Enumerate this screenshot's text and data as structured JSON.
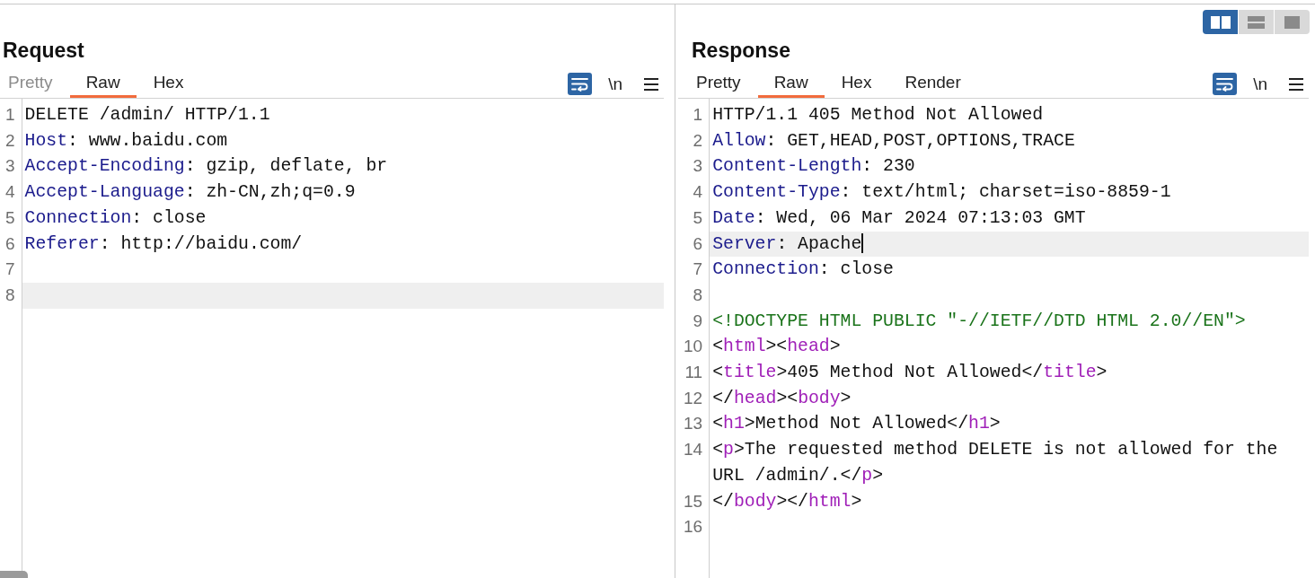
{
  "view_modes": [
    {
      "kind": "columns",
      "selected": true
    },
    {
      "kind": "rows",
      "selected": false
    },
    {
      "kind": "single",
      "selected": false
    }
  ],
  "panels": [
    {
      "title": "Request",
      "focused": false,
      "h_scrollbar": true,
      "tabs": [
        {
          "label": "Pretty",
          "selected": false,
          "disabled": true
        },
        {
          "label": "Raw",
          "selected": true,
          "disabled": false
        },
        {
          "label": "Hex",
          "selected": false,
          "disabled": false
        }
      ],
      "tools": [
        {
          "kind": "wrap",
          "on": true
        },
        {
          "kind": "text",
          "label": "\\n",
          "on": false
        },
        {
          "kind": "menu"
        }
      ],
      "lines": [
        {
          "number": "1",
          "current": false,
          "tokens": [
            {
              "kind": "text",
              "text": "DELETE /admin/ HTTP/1.1"
            }
          ]
        },
        {
          "number": "2",
          "current": false,
          "tokens": [
            {
              "kind": "key",
              "text": "Host"
            },
            {
              "kind": "text",
              "text": ": www.baidu.com"
            }
          ]
        },
        {
          "number": "3",
          "current": false,
          "tokens": [
            {
              "kind": "key",
              "text": "Accept-Encoding"
            },
            {
              "kind": "text",
              "text": ": gzip, deflate, br"
            }
          ]
        },
        {
          "number": "4",
          "current": false,
          "tokens": [
            {
              "kind": "key",
              "text": "Accept-Language"
            },
            {
              "kind": "text",
              "text": ": zh-CN,zh;q=0.9"
            }
          ]
        },
        {
          "number": "5",
          "current": false,
          "tokens": [
            {
              "kind": "key",
              "text": "Connection"
            },
            {
              "kind": "text",
              "text": ": close"
            }
          ]
        },
        {
          "number": "6",
          "current": false,
          "tokens": [
            {
              "kind": "key",
              "text": "Referer"
            },
            {
              "kind": "text",
              "text": ": http://baidu.com/"
            }
          ]
        },
        {
          "number": "7",
          "current": false
        },
        {
          "number": "8",
          "current": true
        }
      ]
    },
    {
      "title": "Response",
      "focused": true,
      "h_scrollbar": false,
      "tabs": [
        {
          "label": "Pretty",
          "selected": false,
          "disabled": false
        },
        {
          "label": "Raw",
          "selected": true,
          "disabled": false
        },
        {
          "label": "Hex",
          "selected": false,
          "disabled": false
        },
        {
          "label": "Render",
          "selected": false,
          "disabled": false
        }
      ],
      "tools": [
        {
          "kind": "wrap",
          "on": true
        },
        {
          "kind": "text",
          "label": "\\n",
          "on": false
        },
        {
          "kind": "menu"
        }
      ],
      "lines": [
        {
          "number": "1",
          "current": false,
          "tokens": [
            {
              "kind": "text",
              "text": "HTTP/1.1 405 Method Not Allowed"
            }
          ]
        },
        {
          "number": "2",
          "current": false,
          "tokens": [
            {
              "kind": "key",
              "text": "Allow"
            },
            {
              "kind": "text",
              "text": ": GET,HEAD,POST,OPTIONS,TRACE"
            }
          ]
        },
        {
          "number": "3",
          "current": false,
          "tokens": [
            {
              "kind": "key",
              "text": "Content-Length"
            },
            {
              "kind": "text",
              "text": ": 230"
            }
          ]
        },
        {
          "number": "4",
          "current": false,
          "tokens": [
            {
              "kind": "key",
              "text": "Content-Type"
            },
            {
              "kind": "text",
              "text": ": text/html; charset=iso-8859-1"
            }
          ]
        },
        {
          "number": "5",
          "current": false,
          "tokens": [
            {
              "kind": "key",
              "text": "Date"
            },
            {
              "kind": "text",
              "text": ": Wed, 06 Mar 2024 07:13:03 GMT"
            }
          ]
        },
        {
          "number": "6",
          "current": true,
          "tokens": [
            {
              "kind": "key",
              "text": "Server"
            },
            {
              "kind": "text",
              "text": ": Apache"
            }
          ]
        },
        {
          "number": "7",
          "current": false,
          "tokens": [
            {
              "kind": "key",
              "text": "Connection"
            },
            {
              "kind": "text",
              "text": ": close"
            }
          ]
        },
        {
          "number": "8",
          "current": false
        },
        {
          "number": "9",
          "current": false,
          "tokens": [
            {
              "kind": "doctype",
              "text": "<!DOCTYPE HTML PUBLIC \"-//IETF//DTD HTML 2.0//EN\">"
            }
          ]
        },
        {
          "number": "10",
          "current": false,
          "tokens": [
            {
              "kind": "text",
              "text": "<"
            },
            {
              "kind": "tag",
              "text": "html"
            },
            {
              "kind": "text",
              "text": "><"
            },
            {
              "kind": "tag",
              "text": "head"
            },
            {
              "kind": "text",
              "text": ">"
            }
          ]
        },
        {
          "number": "11",
          "current": false,
          "tokens": [
            {
              "kind": "text",
              "text": "<"
            },
            {
              "kind": "tag",
              "text": "title"
            },
            {
              "kind": "text",
              "text": ">405 Method Not Allowed</"
            },
            {
              "kind": "tag",
              "text": "title"
            },
            {
              "kind": "text",
              "text": ">"
            }
          ]
        },
        {
          "number": "12",
          "current": false,
          "tokens": [
            {
              "kind": "text",
              "text": "</"
            },
            {
              "kind": "tag",
              "text": "head"
            },
            {
              "kind": "text",
              "text": "><"
            },
            {
              "kind": "tag",
              "text": "body"
            },
            {
              "kind": "text",
              "text": ">"
            }
          ]
        },
        {
          "number": "13",
          "current": false,
          "tokens": [
            {
              "kind": "text",
              "text": "<"
            },
            {
              "kind": "tag",
              "text": "h1"
            },
            {
              "kind": "text",
              "text": ">Method Not Allowed</"
            },
            {
              "kind": "tag",
              "text": "h1"
            },
            {
              "kind": "text",
              "text": ">"
            }
          ]
        },
        {
          "number": "14",
          "current": false,
          "tokens": [
            {
              "kind": "text",
              "text": "<"
            },
            {
              "kind": "tag",
              "text": "p"
            },
            {
              "kind": "text",
              "text": ">The requested method DELETE is not allowed for the URL /admin/.</"
            },
            {
              "kind": "tag",
              "text": "p"
            },
            {
              "kind": "text",
              "text": ">"
            }
          ]
        },
        {
          "number": "15",
          "current": false,
          "tokens": [
            {
              "kind": "text",
              "text": "</"
            },
            {
              "kind": "tag",
              "text": "body"
            },
            {
              "kind": "text",
              "text": "></"
            },
            {
              "kind": "tag",
              "text": "html"
            },
            {
              "kind": "text",
              "text": ">"
            }
          ]
        },
        {
          "number": "16",
          "current": false
        }
      ]
    }
  ]
}
